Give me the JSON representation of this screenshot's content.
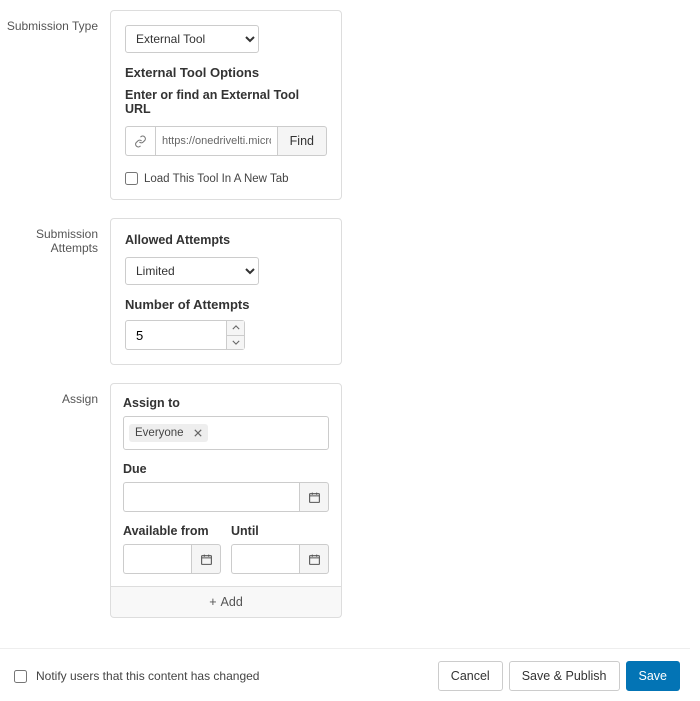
{
  "labels": {
    "submission_type": "Submission Type",
    "submission_attempts": "Submission Attempts",
    "assign": "Assign"
  },
  "submission_type": {
    "selected": "External Tool",
    "options_heading": "External Tool Options",
    "url_heading": "Enter or find an External Tool URL",
    "url_value": "https://onedrivelti.microsoft.com/tool?l",
    "find_label": "Find",
    "new_tab_label": "Load This Tool In A New Tab",
    "new_tab_checked": false
  },
  "attempts": {
    "allowed_heading": "Allowed Attempts",
    "selected": "Limited",
    "number_heading": "Number of Attempts",
    "number_value": "5"
  },
  "assign": {
    "assign_to_label": "Assign to",
    "tokens": [
      "Everyone"
    ],
    "due_label": "Due",
    "due_value": "",
    "available_from_label": "Available from",
    "available_from_value": "",
    "until_label": "Until",
    "until_value": "",
    "add_label": "Add"
  },
  "footer": {
    "notify_label": "Notify users that this content has changed",
    "notify_checked": false,
    "cancel": "Cancel",
    "save_publish": "Save & Publish",
    "save": "Save"
  }
}
